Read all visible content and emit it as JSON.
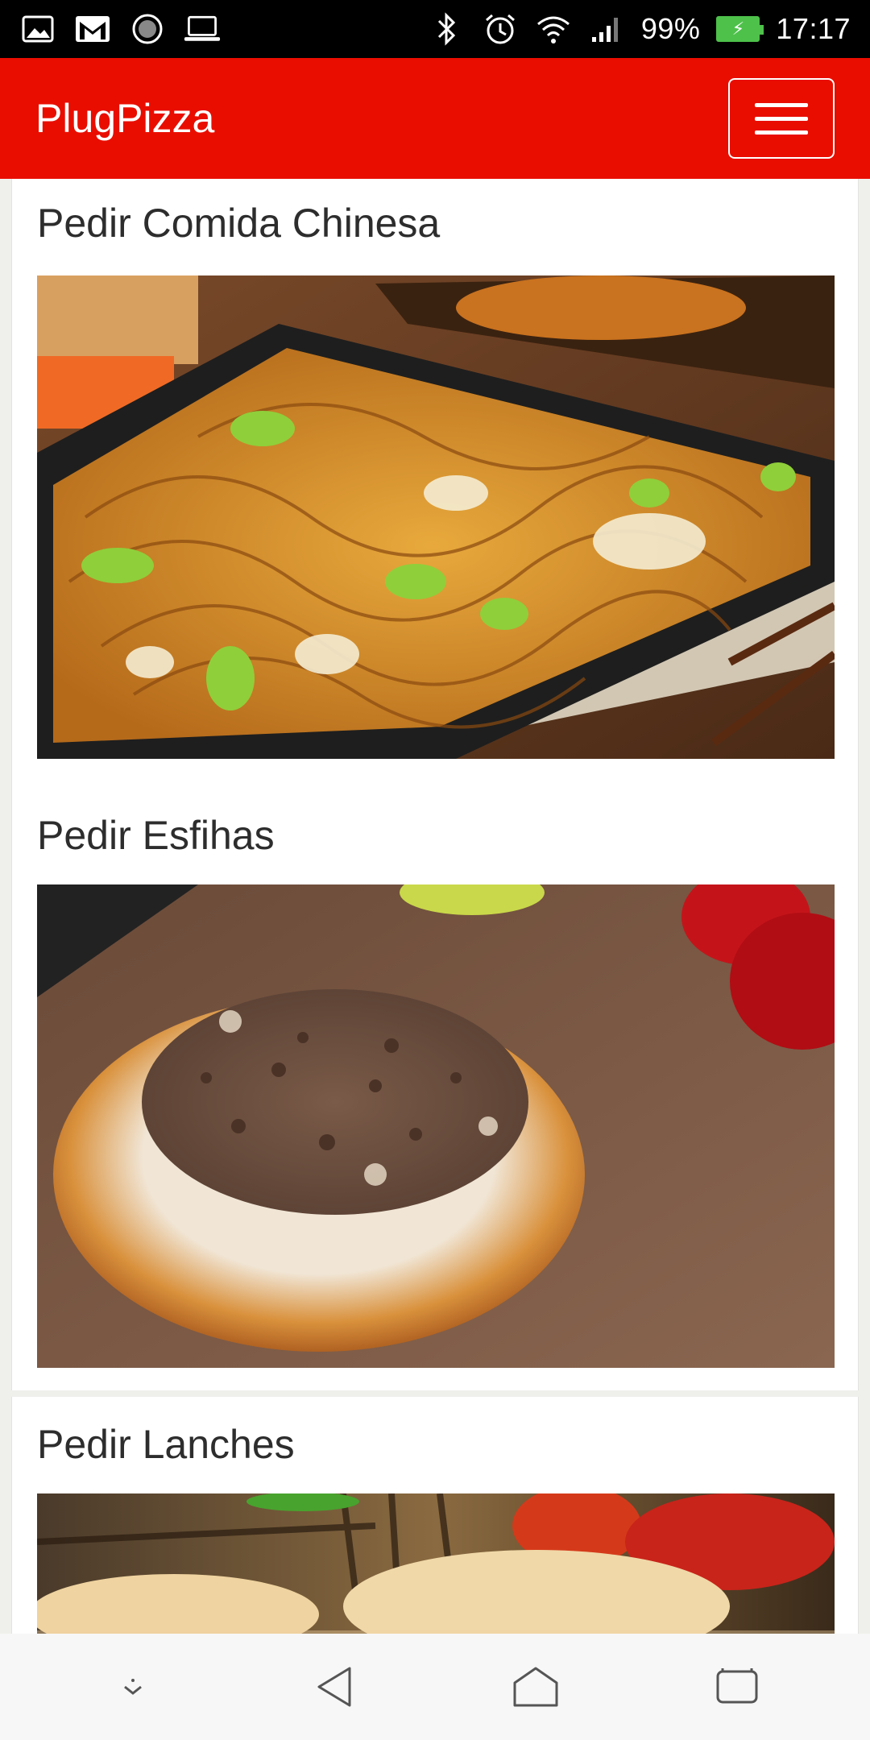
{
  "status_bar": {
    "icons_left": [
      "gallery-icon",
      "gmail-icon",
      "loading-icon",
      "laptop-icon"
    ],
    "icons_right": [
      "bluetooth-icon",
      "alarm-icon",
      "wifi-icon",
      "signal-icon"
    ],
    "battery_percent": "99%",
    "time": "17:17"
  },
  "app_bar": {
    "title": "PlugPizza",
    "menu_icon": "hamburger-icon",
    "color": "#e90d00"
  },
  "cards": [
    {
      "title": "Pedir Comida Chinesa",
      "image": "chinese-noodles-image"
    },
    {
      "title": "Pedir Esfihas",
      "image": "esfiha-image"
    },
    {
      "title": "Pedir Lanches",
      "image": "burger-image"
    }
  ],
  "nav_bar": {
    "buttons": [
      "notification-pull-icon",
      "back-icon",
      "home-icon",
      "recents-icon"
    ]
  }
}
